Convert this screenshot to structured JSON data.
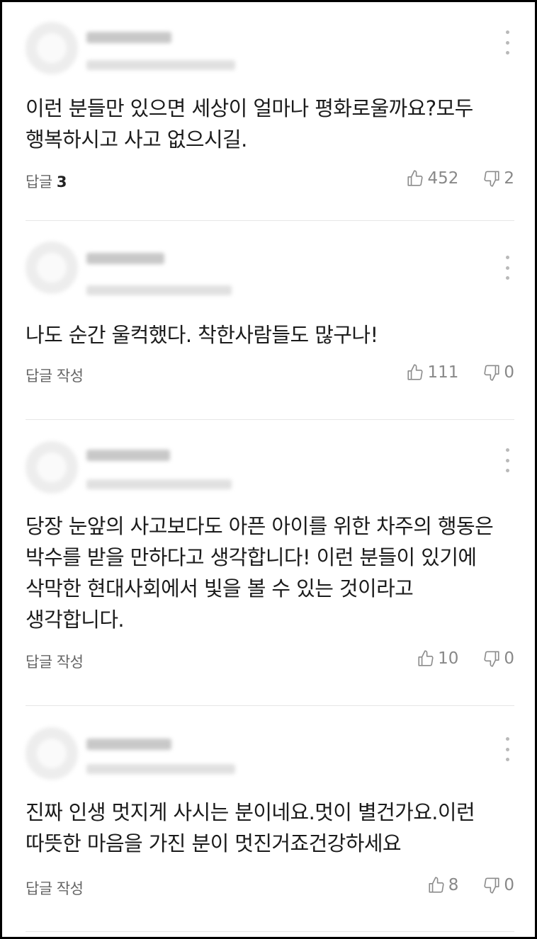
{
  "comments": [
    {
      "text": "이런 분들만 있으면 세상이 얼마나 평화로울까요?모두 행복하시고 사고 없으시길.",
      "reply_label": "답글",
      "reply_count": "3",
      "likes": "452",
      "dislikes": "2"
    },
    {
      "text": "나도 순간 울컥했다. 착한사람들도 많구나!",
      "reply_label": "답글 작성",
      "reply_count": "",
      "likes": "111",
      "dislikes": "0"
    },
    {
      "text": "당장 눈앞의 사고보다도 아픈 아이를 위한 차주의 행동은 박수를 받을 만하다고 생각합니다! 이런 분들이 있기에 삭막한 현대사회에서 빛을 볼 수 있는 것이라고 생각합니다.",
      "reply_label": "답글 작성",
      "reply_count": "",
      "likes": "10",
      "dislikes": "0"
    },
    {
      "text": "진짜 인생 멋지게 사시는 분이네요.멋이 별건가요.이런 따뜻한 마음을 가진 분이 멋진거죠건강하세요",
      "reply_label": "답글 작성",
      "reply_count": "",
      "likes": "8",
      "dislikes": "0"
    }
  ],
  "icons": {
    "like": "thumbs-up-icon",
    "dislike": "thumbs-down-icon",
    "more": "more-vertical-icon"
  },
  "colors": {
    "text": "#1b1b1b",
    "meta": "#888888",
    "divider": "#e6e6e6"
  }
}
